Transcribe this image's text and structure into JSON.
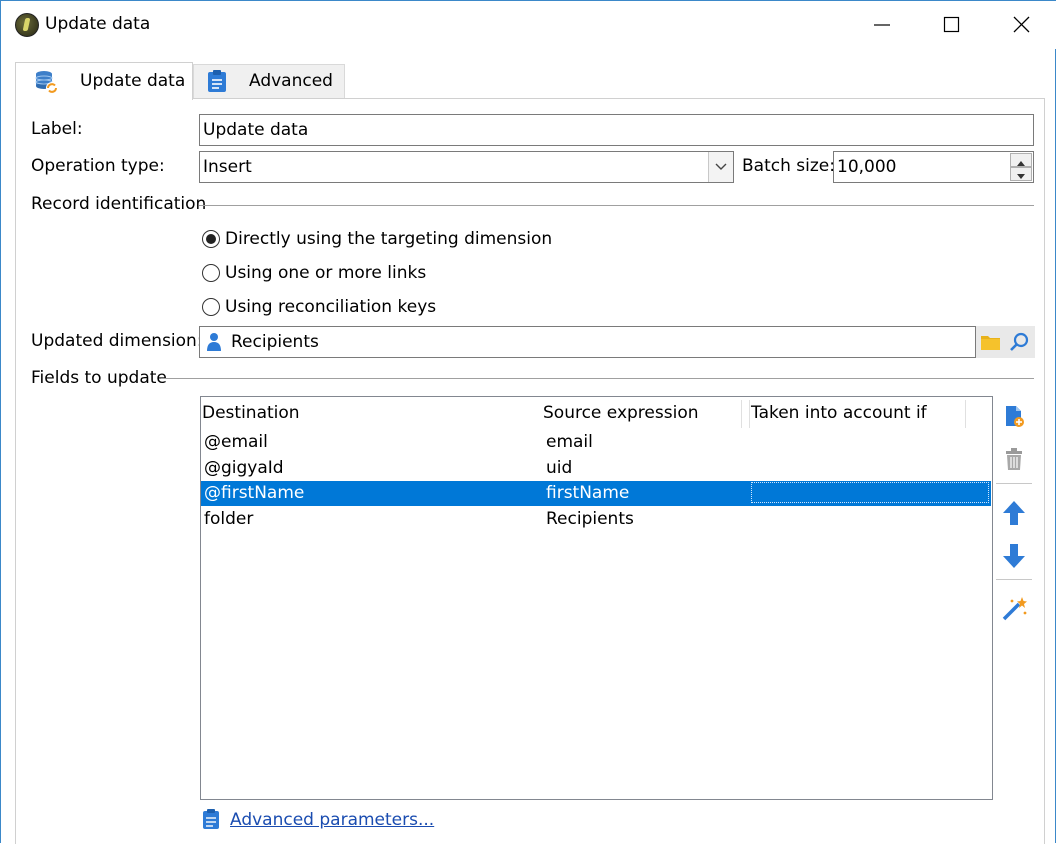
{
  "window": {
    "title": "Update data",
    "controls": {
      "minimize": "minimize",
      "maximize": "maximize",
      "close": "close"
    }
  },
  "tabs": [
    {
      "label": "Update data",
      "icon": "database-sync-icon",
      "active": true
    },
    {
      "label": "Advanced",
      "icon": "clipboard-icon",
      "active": false
    }
  ],
  "form": {
    "label_caption": "Label:",
    "label_value": "Update data",
    "operation_caption": "Operation type:",
    "operation_value": "Insert",
    "batch_caption": "Batch size:",
    "batch_value": "10,000",
    "record_identification": "Record identification",
    "radios": [
      {
        "label": "Directly using the targeting dimension",
        "checked": true
      },
      {
        "label": "Using one or more links",
        "checked": false
      },
      {
        "label": "Using reconciliation keys",
        "checked": false
      }
    ],
    "updated_dimension_caption": "Updated dimension:",
    "updated_dimension_value": "Recipients",
    "fields_to_update": "Fields to update"
  },
  "grid": {
    "columns": [
      "Destination",
      "Source expression",
      "Taken into account if"
    ],
    "rows": [
      {
        "destination": "@email",
        "source": "email",
        "condition": ""
      },
      {
        "destination": "@gigyaId",
        "source": "uid",
        "condition": ""
      },
      {
        "destination": "@firstName",
        "source": "firstName",
        "condition": "",
        "selected": true
      },
      {
        "destination": "folder",
        "source": "Recipients",
        "condition": ""
      }
    ]
  },
  "footer": {
    "advanced_parameters": "Advanced parameters..."
  },
  "colors": {
    "selection": "#0078d7",
    "accent_icon": "#2e7bd6",
    "link": "#1a4cb0"
  }
}
